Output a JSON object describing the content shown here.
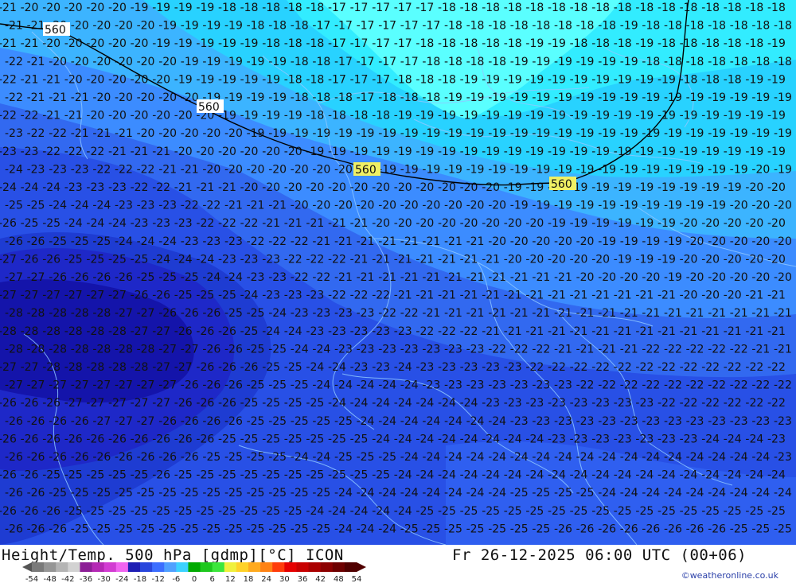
{
  "footer": {
    "title_left": "Height/Temp. 500 hPa [gdmp][°C] ICON",
    "title_right": "Fr 26-12-2025 06:00 UTC (00+06)",
    "credit": "©weatheronline.co.uk"
  },
  "colorbar": {
    "tick_labels": [
      "-54",
      "-48",
      "-42",
      "-36",
      "-30",
      "-24",
      "-18",
      "-12",
      "-6",
      "0",
      "6",
      "12",
      "18",
      "24",
      "30",
      "36",
      "42",
      "48",
      "54"
    ],
    "colors": [
      "#7a7a7a",
      "#969696",
      "#b4b4b4",
      "#d2d2d2",
      "#8c1e96",
      "#b428b4",
      "#d23cd2",
      "#f064f0",
      "#1e1eb4",
      "#2846dc",
      "#3c6eff",
      "#50a0ff",
      "#3cd2ff",
      "#00aa00",
      "#1ec81e",
      "#3ce63c",
      "#f0f03c",
      "#ffd228",
      "#ffaa1e",
      "#ff8214",
      "#ff3c0a",
      "#e60000",
      "#c80000",
      "#aa0000",
      "#8c0000",
      "#6e0000",
      "#500000"
    ]
  },
  "map": {
    "height_labels": [
      {
        "text": "560"
      },
      {
        "text": "560"
      },
      {
        "text": "560"
      },
      {
        "text": "560"
      }
    ],
    "temp_rows": [
      "21 20 20 20 20 20 19 19 19 19 18 18 18 18 18 17 17 17 17 17 18 18 18 18 18 18 18 18 18 18 18 18 18 18 18 18",
      "21 21 20 20 20 20 20 19 19 19 19 18 18 18 17 17 17 17 17 17 18 18 18 18 18 18 18 18 19 18 18 18 18 18 18 18",
      "21 21 20 20 20 20 20 19 19 19 19 19 18 18 18 17 17 17 17 18 18 18 18 18 19 19 18 18 18 19 18 18 18 18 18 19",
      "22 21 20 20 20 20 20 20 19 19 19 19 19 18 18 17 17 17 17 18 18 18 18 19 19 19 19 19 19 18 18 18 18 18 18 18",
      "22 21 21 20 20 20 20 20 19 19 19 19 19 18 18 17 17 17 18 18 18 19 19 19 19 19 19 19 19 19 19 18 18 18 19 19",
      "22 21 21 21 20 20 20 20 20 19 19 19 19 18 18 18 17 18 18 18 19 19 19 19 19 19 19 19 19 19 19 19 19 19 19 19",
      "22 22 21 21 20 20 20 20 20 20 19 19 19 19 18 18 18 18 19 19 19 19 19 19 19 19 19 19 19 19 19 19 19 19 19 19",
      "23 22 22 21 21 21 20 20 20 20 20 19 19 19 19 19 19 19 19 19 19 19 19 19 19 19 19 19 19 19 19 19 19 19 19 19",
      "23 23 22 22 22 21 21 21 20 20 20 20 20 20 19 19 19 19 19 19 19 19 19 19 19 19 19 19 19 19 19 19 19 19 19 19",
      "24 23 23 23 22 22 22 21 21 20 20 20 20 20 20 20 20 19 19 19 19 19 19 19 19 19 19 19 19 19 19 19 19 19 20 19",
      "24 24 24 23 23 23 22 22 21 21 21 20 20 20 20 20 20 20 20 20 20 20 20 19 19 19 19 19 19 19 19 19 19 19 20 20",
      "25 25 24 24 24 23 23 23 22 22 21 21 21 20 20 20 20 20 20 20 20 20 20 19 19 19 19 19 19 19 19 19 19 20 20 20",
      "26 25 25 24 24 24 23 23 23 22 22 22 21 21 21 21 21 20 20 20 20 20 20 20 20 19 19 19 19 19 19 20 20 20 20 20",
      "26 26 25 25 25 24 24 24 23 23 23 22 22 22 21 21 21 21 21 21 21 21 20 20 20 20 20 19 19 19 19 20 20 20 20 20",
      "27 26 26 25 25 25 25 24 24 24 23 23 23 22 22 22 21 21 21 21 21 21 21 20 20 20 20 20 19 19 19 20 20 20 20 20",
      "27 27 26 26 26 26 25 25 25 24 24 23 23 22 22 21 21 21 21 21 21 21 21 21 21 21 20 20 20 20 19 20 20 20 20 20",
      "27 27 27 27 27 27 26 26 25 25 25 24 23 23 23 22 22 22 21 21 21 21 21 21 21 21 21 21 21 21 21 20 20 20 21 21",
      "28 28 28 28 28 27 27 26 26 26 25 25 24 23 23 23 23 22 22 21 21 21 21 21 21 21 21 21 21 21 21 21 21 21 21 21",
      "28 28 28 28 28 28 27 27 26 26 26 25 24 24 23 23 23 23 23 22 22 22 21 21 21 21 21 21 21 21 21 21 21 21 21 21",
      "28 28 28 28 28 28 28 27 27 26 26 25 25 24 24 23 23 23 23 23 23 23 22 22 22 21 21 21 21 22 22 22 22 22 21 21",
      "27 27 28 28 28 28 28 27 27 26 26 26 25 25 24 24 23 23 24 23 23 23 23 23 22 22 22 22 22 22 22 22 22 22 22 22",
      "27 27 27 27 27 27 27 27 26 26 26 25 25 25 24 24 24 24 24 23 23 23 23 23 23 23 22 22 22 22 22 22 22 22 22 22",
      "26 26 26 27 27 27 27 27 26 26 26 25 25 25 25 24 24 24 24 24 24 24 23 23 23 23 23 23 23 23 22 22 22 22 22 22",
      "26 26 26 26 27 27 27 26 26 26 26 25 25 25 25 25 24 24 24 24 24 24 24 23 23 23 23 23 23 23 23 23 23 23 23 23",
      "26 26 26 26 26 26 26 26 26 26 25 25 25 25 25 25 25 24 24 24 24 24 24 24 24 23 23 23 23 23 23 23 24 24 24 23",
      "26 26 26 26 26 26 26 26 26 25 25 25 25 24 24 25 25 25 24 24 24 24 24 24 24 24 24 24 24 24 24 24 24 24 24 23",
      "26 26 25 25 25 25 25 26 25 25 25 25 25 25 25 25 25 25 24 24 24 24 24 24 24 24 24 24 24 24 24 24 24 24 24 24",
      "26 26 25 25 25 25 25 25 25 25 25 25 25 25 25 24 24 24 24 24 24 24 24 25 25 25 25 24 24 24 24 24 24 24 24 24",
      "26 26 26 25 25 25 25 25 25 25 25 25 25 25 24 24 24 24 24 25 25 25 25 25 25 25 25 25 25 25 25 25 25 25 25 25",
      "26 26 26 25 25 25 25 25 25 25 25 25 25 25 25 24 24 24 25 25 25 25 25 25 25 26 26 26 26 26 26 26 26 25 25 25"
    ]
  }
}
